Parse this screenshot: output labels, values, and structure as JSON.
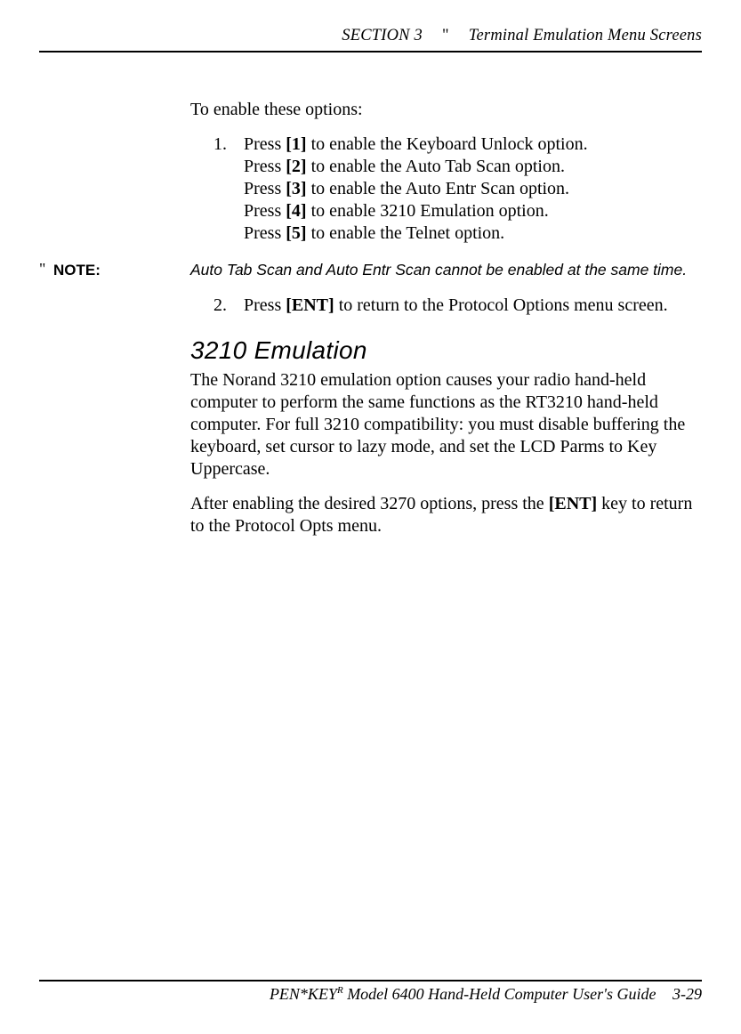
{
  "header": {
    "section": "SECTION 3",
    "separator": "\"",
    "title": "Terminal Emulation Menu Screens"
  },
  "intro": "To enable these options:",
  "step1": {
    "num": "1.",
    "lines": [
      {
        "pre": "Press ",
        "key": "[1]",
        "post": " to enable the Keyboard Unlock option."
      },
      {
        "pre": "Press ",
        "key": "[2]",
        "post": " to enable the Auto Tab Scan option."
      },
      {
        "pre": "Press ",
        "key": "[3]",
        "post": " to enable the Auto Entr Scan option."
      },
      {
        "pre": "Press ",
        "key": "[4]",
        "post": " to enable 3210 Emulation option."
      },
      {
        "pre": "Press ",
        "key": "[5]",
        "post": " to enable the Telnet option."
      }
    ]
  },
  "note": {
    "quote": "\"",
    "label": "NOTE:",
    "body": "Auto Tab Scan and Auto Entr Scan cannot be enabled at the same time."
  },
  "step2": {
    "num": "2.",
    "pre": "Press ",
    "key": "[ENT]",
    "post": " to return to the Protocol Options menu screen."
  },
  "subhead": "3210 Emulation",
  "para1": "The Norand 3210 emulation option causes your radio hand-held computer to perform the same functions as the RT3210 hand-held computer.  For full 3210 compatibility: you must disable buffering the keyboard, set cursor to lazy mode, and set the LCD Parms to Key Uppercase.",
  "para2": {
    "pre": "After enabling the desired 3270 options, press the ",
    "key": "[ENT]",
    "post": " key to return to the Protocol Opts menu."
  },
  "footer": {
    "brand_pre": "PEN*KEY",
    "brand_sup": "R",
    "rest": "  Model 6400 Hand-Held Computer User's Guide",
    "page": "3-29"
  }
}
